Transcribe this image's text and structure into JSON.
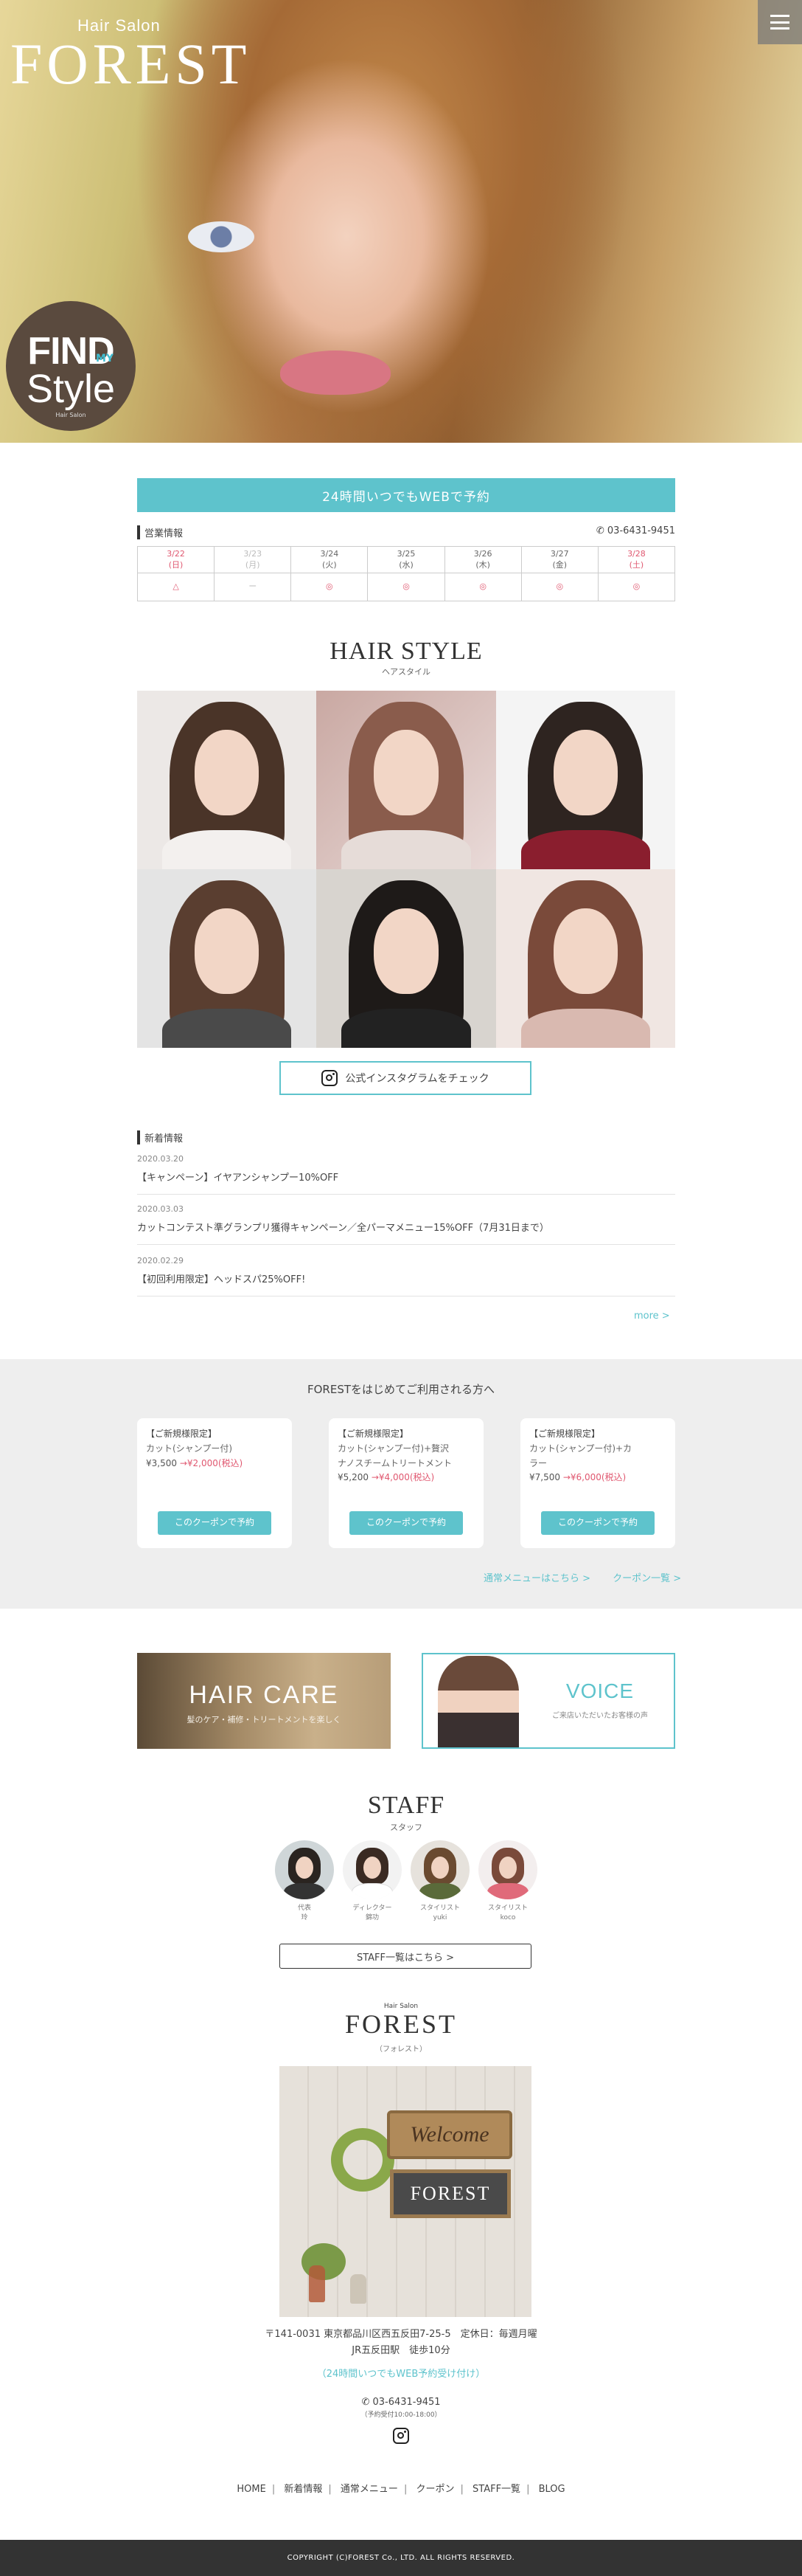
{
  "hero": {
    "brand_small": "Hair Salon",
    "brand_big": "FOREST",
    "badge": {
      "line1": "FIND",
      "line1_small": "MY",
      "line2": "Style",
      "line3": "Hair Salon"
    }
  },
  "reserve": {
    "web_button": "24時間いつでもWEBで予約"
  },
  "hours": {
    "label": "営業情報",
    "phone": "03-6431-9451",
    "days": [
      {
        "date": "3/22",
        "dow": "(日)",
        "status": "△",
        "color": "red"
      },
      {
        "date": "3/23",
        "dow": "(月)",
        "status": "ー",
        "color": "gray"
      },
      {
        "date": "3/24",
        "dow": "(火)",
        "status": "◎",
        "color": "normal"
      },
      {
        "date": "3/25",
        "dow": "(水)",
        "status": "◎",
        "color": "normal"
      },
      {
        "date": "3/26",
        "dow": "(木)",
        "status": "◎",
        "color": "normal"
      },
      {
        "date": "3/27",
        "dow": "(金)",
        "status": "◎",
        "color": "normal"
      },
      {
        "date": "3/28",
        "dow": "(土)",
        "status": "◎",
        "color": "red"
      }
    ]
  },
  "hairstyle": {
    "title": "HAIR STYLE",
    "subtitle": "ヘアスタイル",
    "instagram_button": "公式インスタグラムをチェック"
  },
  "news": {
    "label": "新着情報",
    "items": [
      {
        "date": "2020.03.20",
        "text": "【キャンペーン】イヤアンシャンプー10%OFF"
      },
      {
        "date": "2020.03.03",
        "text": "カットコンテスト準グランプリ獲得キャンペーン／全パーマメニュー15%OFF（7月31日まで）"
      },
      {
        "date": "2020.02.29",
        "text": "【初回利用限定】ヘッドスパ25%OFF!"
      }
    ],
    "more": "more >"
  },
  "coupons": {
    "title": "FORESTをはじめてご利用される方へ",
    "items": [
      {
        "tag": "【ご新規様限定】",
        "name": "カット(シャンプー付)",
        "name2": "",
        "price_old": "¥3,500",
        "price_new": "→¥2,000(税込)",
        "button": "このクーポンで予約"
      },
      {
        "tag": "【ご新規様限定】",
        "name": "カット(シャンプー付)+贅沢",
        "name2": "ナノスチームトリートメント",
        "price_old": "¥5,200",
        "price_new": "→¥4,000(税込)",
        "button": "このクーポンで予約"
      },
      {
        "tag": "【ご新規様限定】",
        "name": "カット(シャンプー付)+カ",
        "name2": "ラー",
        "price_old": "¥7,500",
        "price_new": "→¥6,000(税込)",
        "button": "このクーポンで予約"
      }
    ],
    "link_menu": "通常メニューはこちら >",
    "link_coupons": "クーポン一覧 >"
  },
  "banners": {
    "care": {
      "title": "HAIR CARE",
      "sub": "髪のケア・補修・トリートメントを楽しく"
    },
    "voice": {
      "title": "VOICE",
      "sub": "ご来店いただいたお客様の声"
    }
  },
  "staff": {
    "title": "STAFF",
    "subtitle": "スタッフ",
    "members": [
      {
        "role": "代表",
        "name": "玲"
      },
      {
        "role": "ディレクター",
        "name": "錦功"
      },
      {
        "role": "スタイリスト",
        "name": "yuki"
      },
      {
        "role": "スタイリスト",
        "name": "koco"
      }
    ],
    "button": "STAFF一覧はこちら >"
  },
  "shop": {
    "small": "Hair Salon",
    "big": "FOREST",
    "kana": "（フォレスト）",
    "sign_welcome": "Welcome",
    "sign_name": "FOREST",
    "address": "〒141-0031 東京都品川区西五反田7-25-5　定休日：毎週月曜",
    "access": "JR五反田駅　徒歩10分",
    "web_reserve": "（24時間いつでもWEB予約受け付け）",
    "phone": "03-6431-9451",
    "phone_hours": "（予約受付10:00-18:00）"
  },
  "footer": {
    "nav": [
      "HOME",
      "新着情報",
      "通常メニュー",
      "クーポン",
      "STAFF一覧",
      "BLOG"
    ],
    "copyright": "COPYRIGHT (C)FOREST Co., LTD. ALL RIGHTS RESERVED."
  },
  "colors": {
    "accent": "#5ec3cc",
    "price_red": "#e05870",
    "footer_bg": "#333333"
  }
}
